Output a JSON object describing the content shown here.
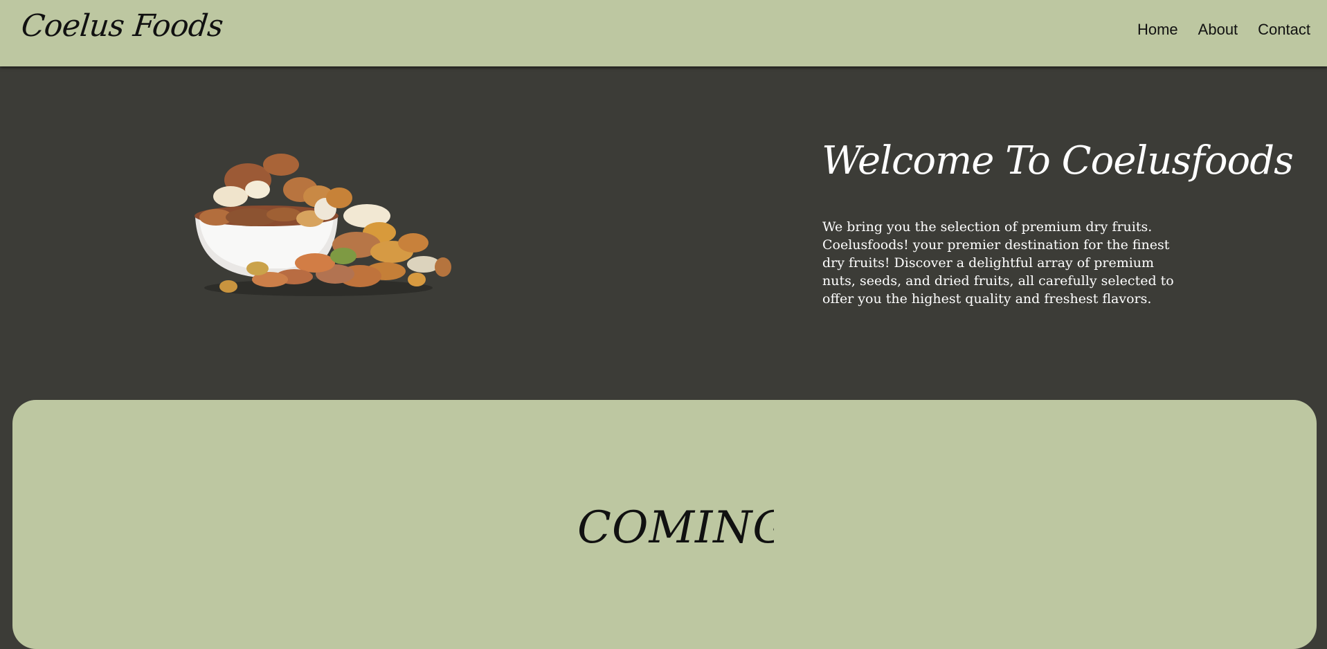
{
  "header": {
    "brand": "Coelus Foods",
    "nav": [
      "Home",
      "About",
      "Contact"
    ]
  },
  "hero": {
    "title": "Welcome To Coelusfoods",
    "body": "We bring you the selection of premium dry fruits. Coelusfoods! your premier destination for the finest dry fruits! Discover a delightful array of premium nuts, seeds, and dried fruits, all carefully selected to offer you the highest quality and freshest flavors.",
    "image_icon": "dry-fruits-bowl-image"
  },
  "coming": {
    "text": "COMING S"
  },
  "colors": {
    "accent": "#bdc7a1",
    "background": "#3c3c37",
    "text_dark": "#111111",
    "text_light": "#ffffff"
  }
}
